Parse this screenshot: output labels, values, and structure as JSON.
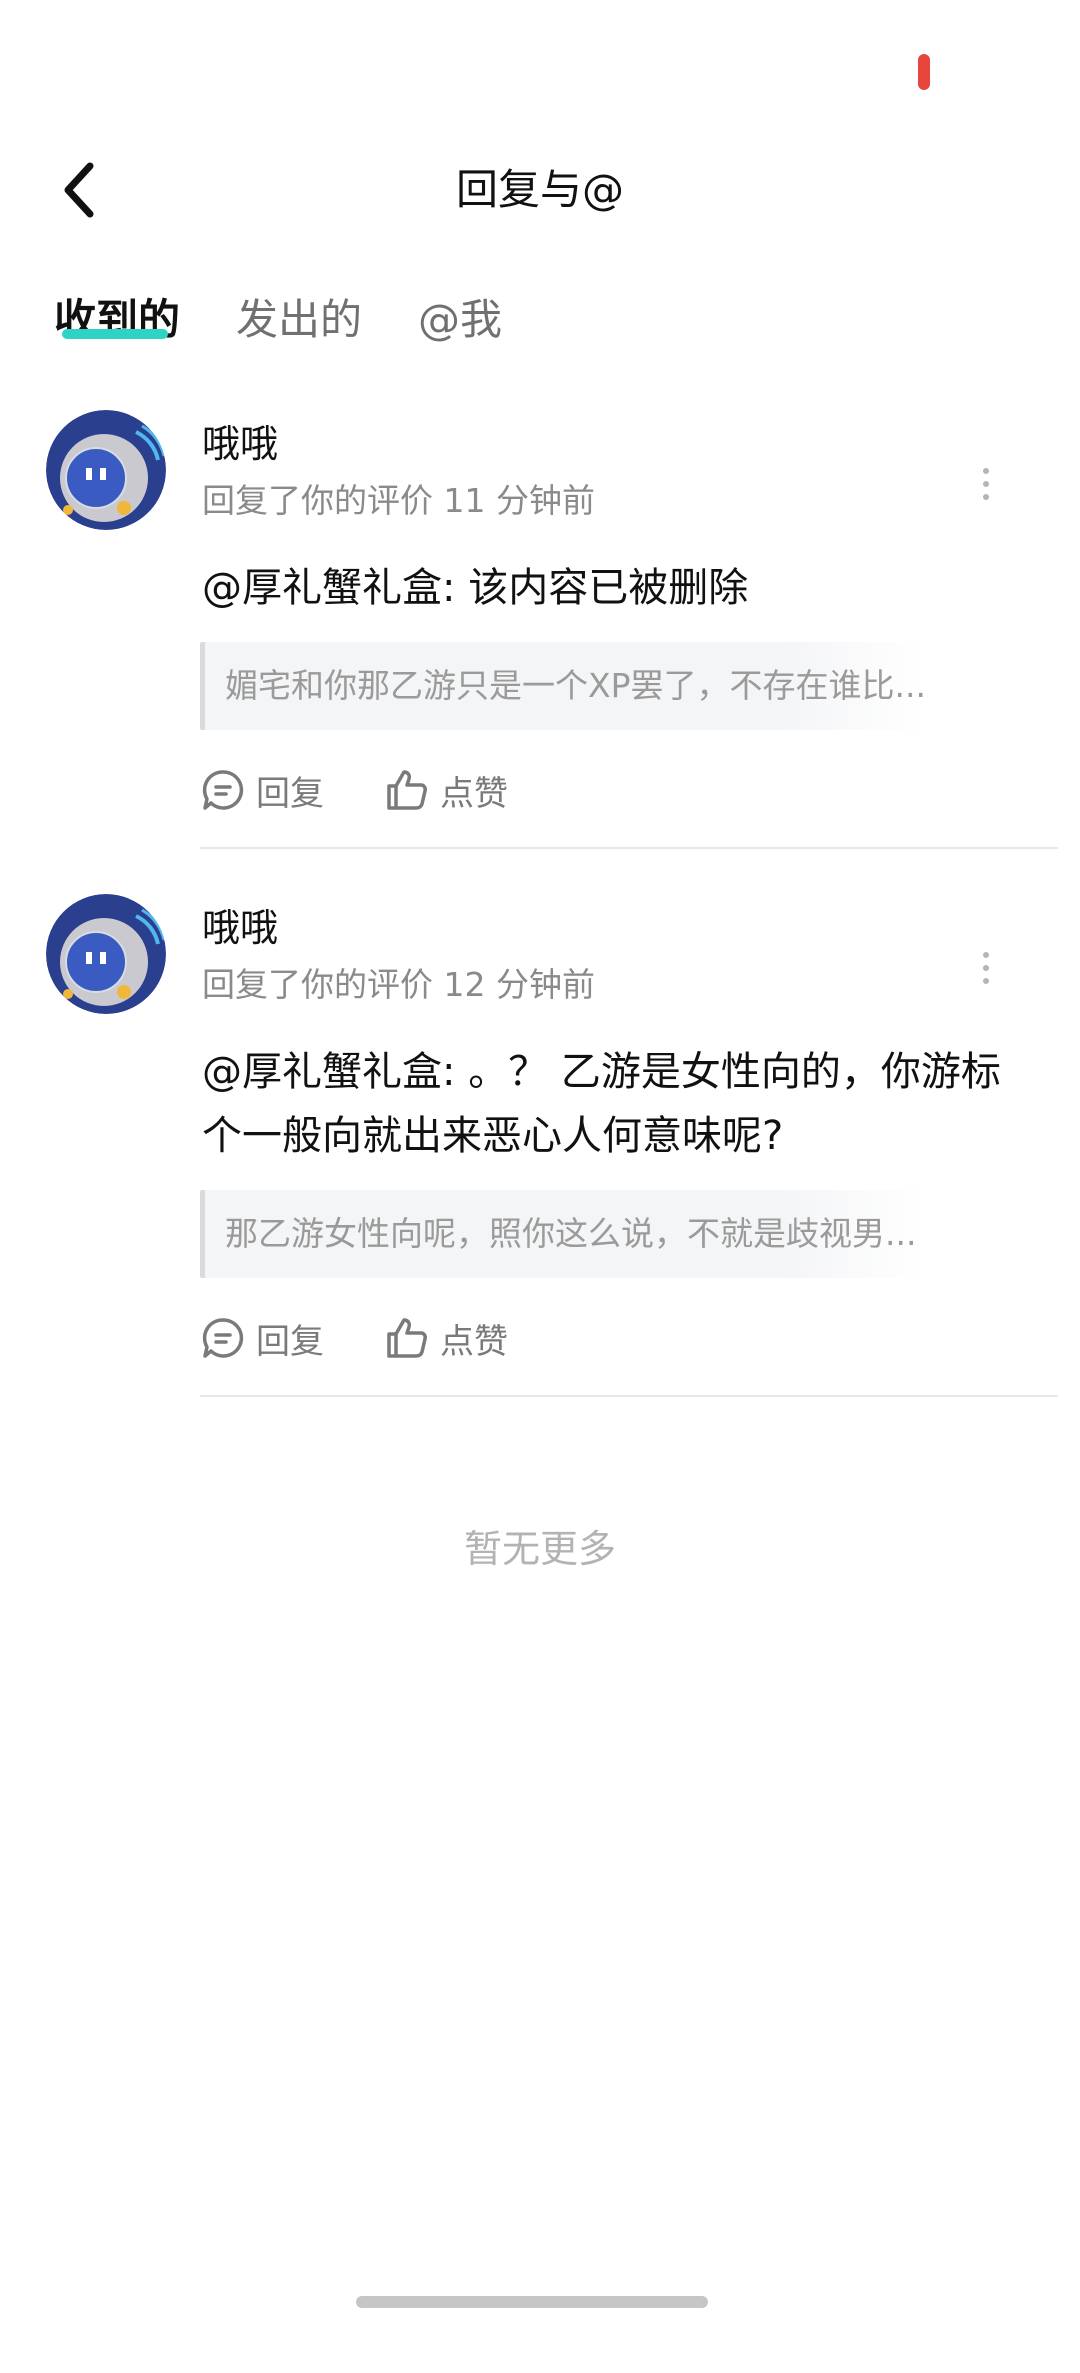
{
  "header": {
    "title": "回复与@",
    "back_icon": "chevron-left-icon"
  },
  "tabs": [
    {
      "label": "收到的",
      "active": true
    },
    {
      "label": "发出的",
      "active": false
    },
    {
      "label": "@我",
      "active": false
    }
  ],
  "colors": {
    "accent": "#2ed3c6",
    "status_indicator": "#e8453c",
    "muted_text": "#8a8a8a"
  },
  "replies": [
    {
      "username": "哦哦",
      "meta": "回复了你的评价 11 分钟前",
      "content": "@厚礼蟹礼盒: 该内容已被删除",
      "quote": "媚宅和你那乙游只是一个XP罢了，不存在谁比...",
      "reply_label": "回复",
      "like_label": "点赞"
    },
    {
      "username": "哦哦",
      "meta": "回复了你的评价 12 分钟前",
      "content": "@厚礼蟹礼盒: 。？ 乙游是女性向的，你游标个一般向就出来恶心人何意味呢?",
      "quote": "那乙游女性向呢，照你这么说，不就是歧视男...",
      "reply_label": "回复",
      "like_label": "点赞"
    }
  ],
  "footer": {
    "no_more": "暂无更多"
  }
}
